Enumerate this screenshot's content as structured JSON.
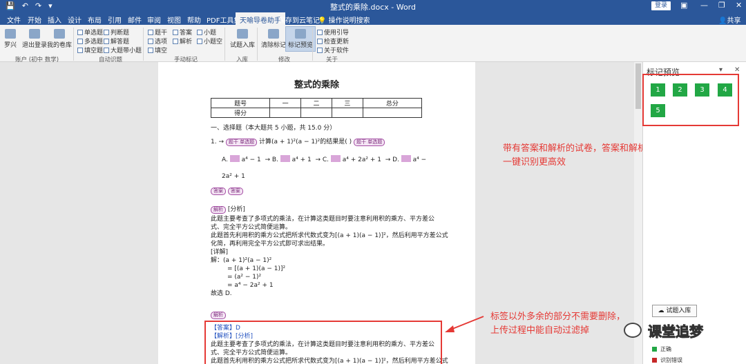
{
  "titlebar": {
    "doc_title": "整式的乘除.docx - Word",
    "login": "登录",
    "qat": [
      "💾",
      "↶",
      "↷",
      "▾"
    ],
    "controls": [
      "▣",
      "—",
      "❐",
      "✕"
    ]
  },
  "tabs": [
    "文件",
    "开始",
    "插入",
    "设计",
    "布局",
    "引用",
    "邮件",
    "审阅",
    "视图",
    "帮助",
    "PDF工具集",
    "天喻导卷助手",
    "保存到云笔记"
  ],
  "tellme": "操作说明搜索",
  "share": "共享",
  "ribbon": {
    "account": {
      "user": "罗兴",
      "logout": "退出登录",
      "my_papers": "我的卷库",
      "label": "账户 (初中 数学)"
    },
    "auto": {
      "single": "单选题",
      "multi": "多选题",
      "fill": "填空题",
      "judge": "判断题",
      "answer_q": "解答题",
      "big_small": "大题带小题",
      "label": "自动识题"
    },
    "manual": {
      "stem": "题干",
      "option": "选项",
      "fill_blank": "填空",
      "answer": "答案",
      "analysis": "解析",
      "small": "小题",
      "small_blank": "小题空",
      "label": "手动标记"
    },
    "import": {
      "btn": "试题入库",
      "label": "入库"
    },
    "modify": {
      "clear": "清除标记",
      "preview": "标记预览",
      "label": "修改"
    },
    "about": {
      "guide": "使用引导",
      "update": "检查更新",
      "software": "关于软件",
      "label": "关于"
    }
  },
  "doc": {
    "title": "整式的乘除",
    "score_table": [
      [
        "题号",
        "一",
        "二",
        "三",
        "总分"
      ],
      [
        "得分",
        "",
        "",
        "",
        ""
      ]
    ],
    "section": "一、选择题（本大题共 5 小题，共 15.0 分）",
    "q1_tag_stem": "题干 单选题",
    "q1_text": "计算(a + 1)²(a − 1)²的结果是(    )",
    "q1_tag_right": "题干 单选题",
    "options_a": "A. ",
    "options_a_val": "a⁴ − 1",
    "options_b": "B. ",
    "options_b_val": "a⁴ + 1",
    "options_c": "C. ",
    "options_c_val": "a⁴ + 2a² + 1",
    "options_d": "D. ",
    "options_d_val": "a⁴ −",
    "opt_cont": "2a² + 1",
    "answer_tag": "答案",
    "answer_tag2": "答案",
    "analysis_tag": "解析",
    "analysis_head": "[分析]",
    "p1": "此题主要考查了多项式的乘法，在计算这类题目时要注意利用积的乘方、平方差公",
    "p2": "式、完全平方公式简便运算。",
    "p3": "此题首先利用积的乘方公式把所求代数式变为[(a + 1)(a − 1)]²，然后利用平方差公式",
    "p4": "化简，再利用完全平方公式即可求出结果。",
    "detail": "[详解]",
    "s1": "解：(a + 1)²(a − 1)²",
    "s2": "= [(a + 1)(a − 1)]²",
    "s3": "= (a² − 1)²",
    "s4": "= a⁴ − 2a² + 1",
    "s5": "故选 D.",
    "analysis_tag2": "解析",
    "box_answer": "【答案】D",
    "box_analysis": "【解析】[分析]",
    "box_p1": "此题主要考查了多项式的乘法，在计算这类题目时要注意利用积的乘方、平方差公",
    "box_p2": "式、完全平方公式简便运算。",
    "box_p3": "此题首先利用积的乘方公式把所求代数式变为[(a + 1)(a − 1)]²，然后利用平方差公式"
  },
  "callouts": {
    "top": [
      "带有答案和解析的试卷，答案和解析能自动回填，",
      "一键识别更高效"
    ],
    "bottom": [
      "标签以外多余的部分不需要删除，",
      "上传过程中能自动过滤掉"
    ]
  },
  "pane": {
    "title": "标记预览",
    "questions": [
      "1",
      "2",
      "3",
      "4",
      "5"
    ],
    "import": "试题入库",
    "legend_correct": "正确",
    "legend_error": "识别错误",
    "colors": {
      "correct": "#22a745",
      "error": "#c62828"
    }
  },
  "watermark": "课堂追梦"
}
